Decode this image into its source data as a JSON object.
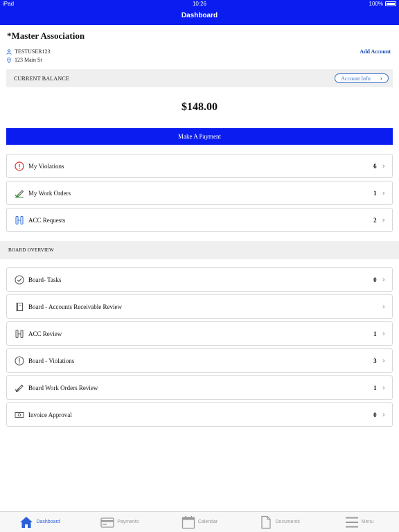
{
  "status": {
    "device": "iPad",
    "time": "10:26",
    "battery": "100%"
  },
  "header": {
    "title": "Dashboard"
  },
  "account": {
    "name": "*Master Association",
    "username": "TESTUSER123",
    "address": "123 Main St",
    "add_account_label": "Add Account"
  },
  "balance": {
    "label": "CURRENT BALANCE",
    "account_info_label": "Account Info",
    "amount": "$148.00",
    "pay_label": "Make A Payment"
  },
  "my_items": [
    {
      "label": "My Violations",
      "count": "6",
      "icon": "alert-circle-icon"
    },
    {
      "label": "My Work Orders",
      "count": "1",
      "icon": "pencil-check-icon"
    },
    {
      "label": "ACC Requests",
      "count": "2",
      "icon": "acc-columns-icon"
    }
  ],
  "board": {
    "section_label": "BOARD OVERVIEW",
    "items": [
      {
        "label": "Board- Tasks",
        "count": "0",
        "icon": "check-circle-icon"
      },
      {
        "label": "Board - Accounts Receivable Review",
        "count": "",
        "icon": "book-icon"
      },
      {
        "label": "ACC Review",
        "count": "1",
        "icon": "acc-columns-icon"
      },
      {
        "label": "Board - Violations",
        "count": "3",
        "icon": "alert-circle-icon"
      },
      {
        "label": "Board Work Orders Review",
        "count": "1",
        "icon": "pencil-icon"
      },
      {
        "label": "Invoice Approval",
        "count": "0",
        "icon": "money-icon"
      }
    ]
  },
  "tabs": [
    {
      "label": "Dashboard",
      "icon": "home-icon",
      "active": true
    },
    {
      "label": "Payments",
      "icon": "credit-card-icon",
      "active": false
    },
    {
      "label": "Calendar",
      "icon": "calendar-icon",
      "active": false
    },
    {
      "label": "Documents",
      "icon": "document-icon",
      "active": false
    },
    {
      "label": "Menu",
      "icon": "menu-icon",
      "active": false
    }
  ],
  "colors": {
    "primary": "#0a1cf0",
    "link": "#1a4db8",
    "alert": "#d9332b",
    "success": "#3a9a3a",
    "tab_active": "#2a5fd8"
  }
}
